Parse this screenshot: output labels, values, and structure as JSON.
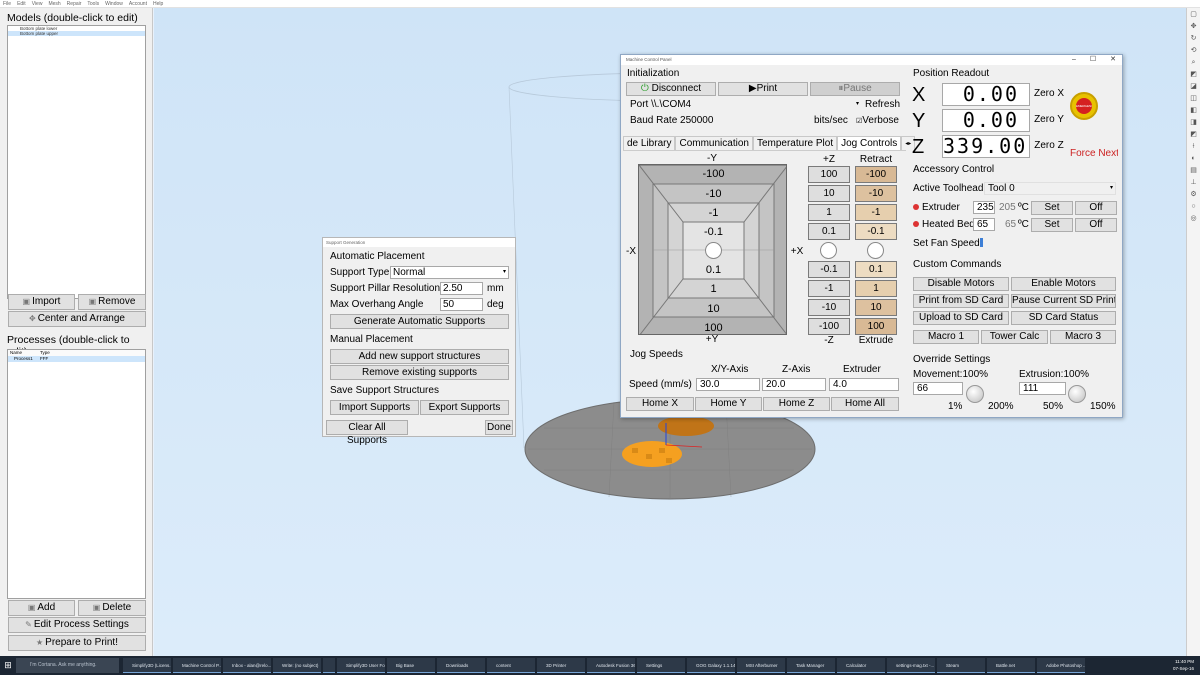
{
  "menubar": [
    "File",
    "Edit",
    "View",
    "Mesh",
    "Repair",
    "Tools",
    "Window",
    "Account",
    "Help"
  ],
  "left": {
    "models_title": "Models (double-click to edit)",
    "models": [
      "Bottom plate lower",
      "Bottom plate upper"
    ],
    "import_label": "Import",
    "remove_label": "Remove",
    "center_label": "Center and Arrange",
    "processes_title": "Processes (double-click to edit)",
    "proc_col_name": "Name",
    "proc_col_type": "Type",
    "proc_name": "Process1",
    "proc_type": "FFF",
    "add_label": "Add",
    "delete_label": "Delete",
    "edit_label": "Edit Process Settings",
    "prepare_label": "Prepare to Print!"
  },
  "support": {
    "title": "Support Generation",
    "auto_title": "Automatic Placement",
    "type_label": "Support Type",
    "type_value": "Normal",
    "res_label": "Support Pillar Resolution",
    "res_value": "2.50",
    "res_unit": "mm",
    "angle_label": "Max Overhang Angle",
    "angle_value": "50",
    "angle_unit": "deg",
    "generate_label": "Generate Automatic Supports",
    "manual_title": "Manual Placement",
    "add_new_label": "Add new support structures",
    "remove_existing_label": "Remove existing supports",
    "save_title": "Save Support Structures",
    "import_label": "Import Supports",
    "export_label": "Export Supports",
    "clear_label": "Clear All Supports",
    "done_label": "Done"
  },
  "mcp": {
    "title": "Machine Control Panel",
    "init_title": "Initialization",
    "disconnect_label": "Disconnect",
    "print_label": "Print",
    "pause_label": "Pause",
    "port_label": "Port \\\\.\\COM4",
    "refresh_label": "Refresh",
    "baud_label": "Baud Rate",
    "baud_value": "250000",
    "bits_label": "bits/sec",
    "verbose_label": "Verbose",
    "tabs": [
      "de Library",
      "Communication",
      "Temperature Plot",
      "Jog Controls"
    ],
    "jog": {
      "minus_y": "-Y",
      "plus_y": "+Y",
      "minus_x": "-X",
      "plus_x": "+X",
      "y_rings": [
        "-100",
        "-10",
        "-1",
        "-0.1",
        "0.1",
        "1",
        "10",
        "100"
      ],
      "plus_z": "+Z",
      "minus_z": "-Z",
      "z_buttons": [
        "100",
        "10",
        "1",
        "0.1",
        "-0.1",
        "-1",
        "-10",
        "-100"
      ],
      "retract": "Retract",
      "extrude": "Extrude",
      "e_buttons": [
        "-100",
        "-10",
        "-1",
        "-0.1",
        "0.1",
        "1",
        "10",
        "100"
      ]
    },
    "speeds_title": "Jog Speeds",
    "xy_label": "X/Y-Axis",
    "z_label": "Z-Axis",
    "ext_label": "Extruder",
    "speed_label": "Speed (mm/s)",
    "xy_speed": "30.0",
    "z_speed": "20.0",
    "ext_speed": "4.0",
    "home_x": "Home X",
    "home_y": "Home Y",
    "home_z": "Home Z",
    "home_all": "Home All",
    "pos_title": "Position Readout",
    "x_letter": "X",
    "y_letter": "Y",
    "z_letter": "Z",
    "x_pos": "0.00",
    "y_pos": "0.00",
    "z_pos": "339.00",
    "zero_x": "Zero X",
    "zero_y": "Zero Y",
    "zero_z": "Zero Z",
    "force_next": "Force Next",
    "acc_title": "Accessory Control",
    "toolhead_label": "Active Toolhead",
    "toolhead_value": "Tool 0",
    "extruder_label": "Extruder",
    "extruder_set": "235",
    "extruder_cur": "205",
    "bed_label": "Heated Bed",
    "bed_set": "65",
    "bed_cur": "65",
    "deg_unit": "ºC",
    "set_label": "Set",
    "off_label": "Off",
    "fan_label": "Set Fan Speed",
    "cmd_title": "Custom Commands",
    "disable_motors": "Disable Motors",
    "enable_motors": "Enable Motors",
    "print_sd": "Print from SD Card",
    "pause_sd": "Pause Current SD Print",
    "upload_sd": "Upload to SD Card",
    "sd_status": "SD Card Status",
    "macro1": "Macro 1",
    "tower_calc": "Tower Calc",
    "macro3": "Macro 3",
    "override_title": "Override Settings",
    "movement_label": "Movement:100%",
    "movement_value": "66",
    "movement_min": "1%",
    "movement_max": "200%",
    "extrusion_label": "Extrusion:100%",
    "extrusion_value": "111",
    "extrusion_min": "50%",
    "extrusion_max": "150%",
    "estop_text": "EMERGENCY STOP"
  },
  "taskbar": {
    "search_placeholder": "I'm Cortana. Ask me anything.",
    "tasks": [
      "Simplify3D (Licens...",
      "Machine Control P...",
      "Inbox - alan@relo...",
      "Write: (no subject)",
      "",
      "Simplify3D User Fo...",
      "Big Base",
      "Downloads",
      "content",
      "3D Printer",
      "Autodesk Fusion 360",
      "Settings",
      "GOG Galaxy 1.1.14...",
      "MSI Afterburner",
      "Task Manager",
      "Calculator",
      "settings-mag.txt -...",
      "Steam",
      "Battle.net",
      "Adobe Photoshop ..."
    ],
    "time": "11:40 PM",
    "date": "07-Sep-16"
  },
  "colors": {
    "viewport_top": "#cfe4f7",
    "extrude_button": "#d8b995",
    "force_next": "#cc2222",
    "model_orange": "#f5a020"
  }
}
